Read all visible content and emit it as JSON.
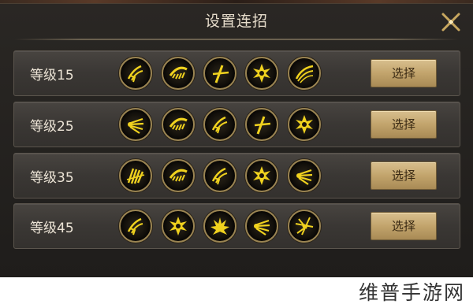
{
  "dialog": {
    "title": "设置连招"
  },
  "rows": [
    {
      "label": "等级15",
      "button": "选择",
      "skills": [
        "claw-strike-icon",
        "comb-slash-icon",
        "cross-slash-icon",
        "burst-star-icon",
        "wave-slash-icon"
      ]
    },
    {
      "label": "等级25",
      "button": "选择",
      "skills": [
        "wing-slash-icon",
        "comb-slash-icon",
        "claw-strike-icon",
        "cross-slash-icon",
        "burst-star-icon"
      ]
    },
    {
      "label": "等级35",
      "button": "选择",
      "skills": [
        "feather-slash-icon",
        "comb-slash-icon",
        "claw-strike-icon",
        "burst-star-icon",
        "wing-slash-icon"
      ]
    },
    {
      "label": "等级45",
      "button": "选择",
      "skills": [
        "claw-strike-icon",
        "burst-star-icon",
        "flame-burst-icon",
        "wing-slash-icon",
        "spark-slash-icon"
      ]
    }
  ],
  "colors": {
    "glyph": "#f0d21e",
    "ring": "#9a8452",
    "button": "#c2a46c"
  },
  "watermark": "维普手游网"
}
